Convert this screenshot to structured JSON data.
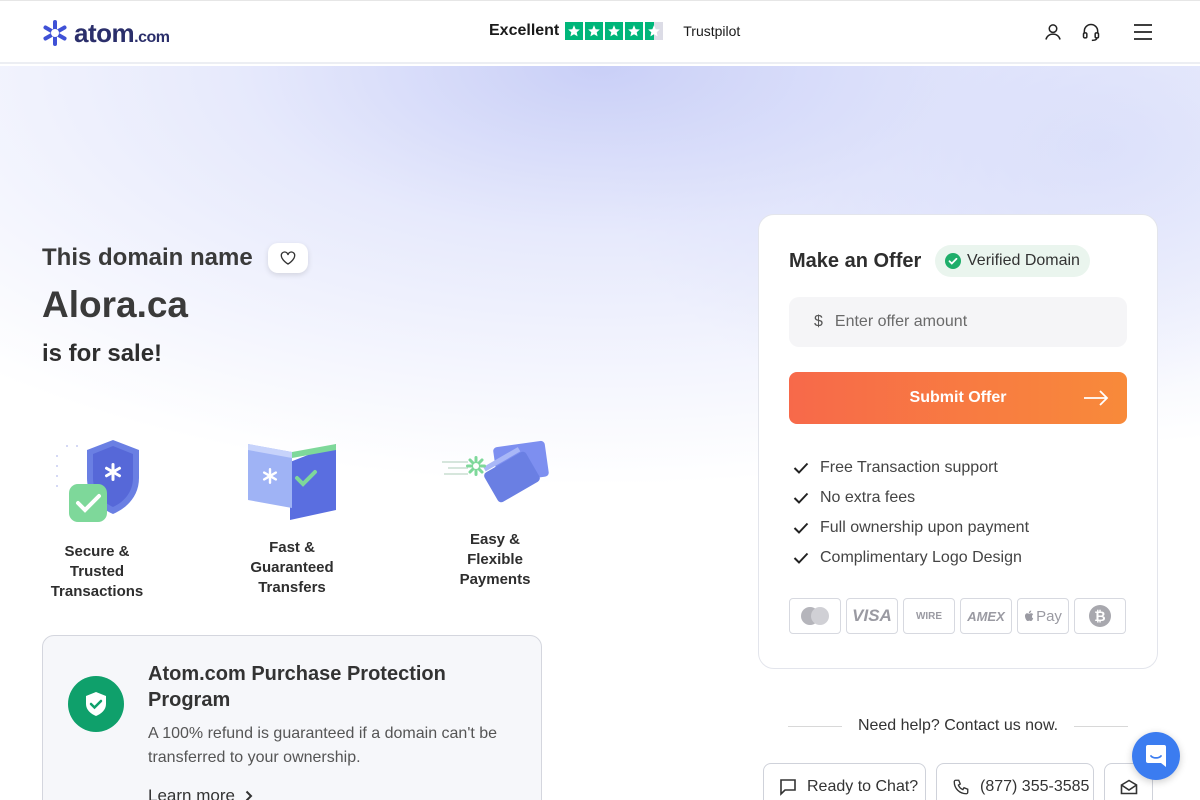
{
  "header": {
    "logo_text": "atom",
    "logo_suffix": ".com",
    "rating_text": "Excellent",
    "rating_stars": 4.5,
    "review_site": "Trustpilot",
    "icons": [
      "user-icon",
      "headset-icon",
      "menu-icon"
    ]
  },
  "hero": {
    "intro": "This domain name",
    "domain": "Alora.ca",
    "for_sale": "is for sale!"
  },
  "features": [
    {
      "label": "Secure & Trusted Transactions",
      "icon": "shield-check-icon"
    },
    {
      "label": "Fast & Guaranteed Transfers",
      "icon": "transfer-icon"
    },
    {
      "label": "Easy & Flexible Payments",
      "icon": "cards-icon"
    }
  ],
  "protection": {
    "title": "Atom.com Purchase Protection Program",
    "description": "A 100% refund is guaranteed if a domain can't be transferred to your ownership.",
    "link": "Learn more"
  },
  "offer": {
    "title": "Make an Offer",
    "verified_label": "Verified Domain",
    "currency_symbol": "$",
    "input_placeholder": "Enter offer amount",
    "submit_label": "Submit Offer",
    "benefits": [
      "Free Transaction support",
      "No extra fees",
      "Full ownership upon payment",
      "Complimentary Logo Design"
    ],
    "payment_methods": [
      "mastercard-icon",
      "visa-icon",
      "wire-transfer-icon",
      "amex-icon",
      "apple-pay-icon",
      "bitcoin-icon"
    ],
    "pay_labels": {
      "visa": "VISA",
      "wire": "WIRE",
      "amex": "AMEX",
      "applepay": "Pay"
    }
  },
  "help": {
    "heading": "Need help? Contact us now.",
    "chat_label": "Ready to Chat?",
    "phone": "(877) 355-3585"
  },
  "colors": {
    "brand": "#2b2f6b",
    "accent": "#f7694a",
    "trustpilot": "#00b67a",
    "success": "#0fa06b",
    "chat_fab": "#3b7cf0"
  }
}
